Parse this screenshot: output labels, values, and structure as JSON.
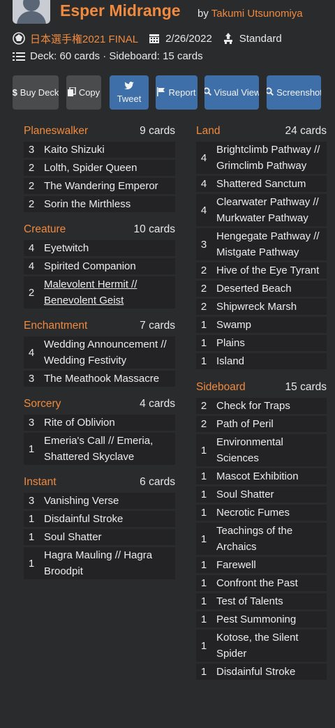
{
  "deck": {
    "title": "Esper Midrange",
    "by_label": "by",
    "author": "Takumi Utsunomiya",
    "event": "日本選手権2021 FINAL",
    "date": "2/26/2022",
    "format": "Standard",
    "counts": "Deck: 60 cards · Sideboard: 15 cards"
  },
  "buttons": [
    {
      "label": "Buy Deck",
      "icon": "dollar-icon"
    },
    {
      "label": "Copy",
      "icon": "copy-icon"
    },
    {
      "label": "Tweet",
      "icon": "twitter-icon"
    },
    {
      "label": "Report",
      "icon": "flag-icon"
    },
    {
      "label": "Visual View",
      "icon": "search-icon"
    },
    {
      "label": "Screenshot",
      "icon": "search-icon"
    }
  ],
  "left_sections": [
    {
      "title": "Planeswalker",
      "count": "9 cards",
      "cards": [
        {
          "qty": "3",
          "name": "Kaito Shizuki"
        },
        {
          "qty": "2",
          "name": "Lolth, Spider Queen"
        },
        {
          "qty": "2",
          "name": "The Wandering Emperor"
        },
        {
          "qty": "2",
          "name": "Sorin the Mirthless"
        }
      ]
    },
    {
      "title": "Creature",
      "count": "10 cards",
      "cards": [
        {
          "qty": "4",
          "name": "Eyetwitch"
        },
        {
          "qty": "4",
          "name": "Spirited Companion"
        },
        {
          "qty": "2",
          "name": "Malevolent Hermit // Benevolent Geist",
          "underline": true
        }
      ]
    },
    {
      "title": "Enchantment",
      "count": "7 cards",
      "cards": [
        {
          "qty": "4",
          "name": "Wedding Announcement // Wedding Festivity"
        },
        {
          "qty": "3",
          "name": "The Meathook Massacre"
        }
      ]
    },
    {
      "title": "Sorcery",
      "count": "4 cards",
      "cards": [
        {
          "qty": "3",
          "name": "Rite of Oblivion"
        },
        {
          "qty": "1",
          "name": "Emeria's Call // Emeria, Shattered Skyclave"
        }
      ]
    },
    {
      "title": "Instant",
      "count": "6 cards",
      "cards": [
        {
          "qty": "3",
          "name": "Vanishing Verse"
        },
        {
          "qty": "1",
          "name": "Disdainful Stroke"
        },
        {
          "qty": "1",
          "name": "Soul Shatter"
        },
        {
          "qty": "1",
          "name": "Hagra Mauling // Hagra Broodpit"
        }
      ]
    }
  ],
  "right_sections": [
    {
      "title": "Land",
      "count": "24 cards",
      "cards": [
        {
          "qty": "4",
          "name": "Brightclimb Pathway // Grimclimb Pathway"
        },
        {
          "qty": "4",
          "name": "Shattered Sanctum"
        },
        {
          "qty": "4",
          "name": "Clearwater Pathway // Murkwater Pathway"
        },
        {
          "qty": "3",
          "name": "Hengegate Pathway // Mistgate Pathway"
        },
        {
          "qty": "2",
          "name": "Hive of the Eye Tyrant"
        },
        {
          "qty": "2",
          "name": "Deserted Beach"
        },
        {
          "qty": "2",
          "name": "Shipwreck Marsh"
        },
        {
          "qty": "1",
          "name": "Swamp"
        },
        {
          "qty": "1",
          "name": "Plains"
        },
        {
          "qty": "1",
          "name": "Island"
        }
      ]
    },
    {
      "title": "Sideboard",
      "count": "15 cards",
      "cards": [
        {
          "qty": "2",
          "name": "Check for Traps"
        },
        {
          "qty": "2",
          "name": "Path of Peril"
        },
        {
          "qty": "1",
          "name": "Environmental Sciences"
        },
        {
          "qty": "1",
          "name": "Mascot Exhibition"
        },
        {
          "qty": "1",
          "name": "Soul Shatter"
        },
        {
          "qty": "1",
          "name": "Necrotic Fumes"
        },
        {
          "qty": "1",
          "name": "Teachings of the Archaics"
        },
        {
          "qty": "1",
          "name": "Farewell"
        },
        {
          "qty": "1",
          "name": "Confront the Past"
        },
        {
          "qty": "1",
          "name": "Test of Talents"
        },
        {
          "qty": "1",
          "name": "Pest Summoning"
        },
        {
          "qty": "1",
          "name": "Kotose, the Silent Spider"
        },
        {
          "qty": "1",
          "name": "Disdainful Stroke"
        }
      ]
    }
  ],
  "colors": {
    "accent": "#f08a3e",
    "bg": "#2a2b2d",
    "row": "#232325",
    "blue": "#3e6fa8",
    "gray": "#4a4b4d"
  }
}
